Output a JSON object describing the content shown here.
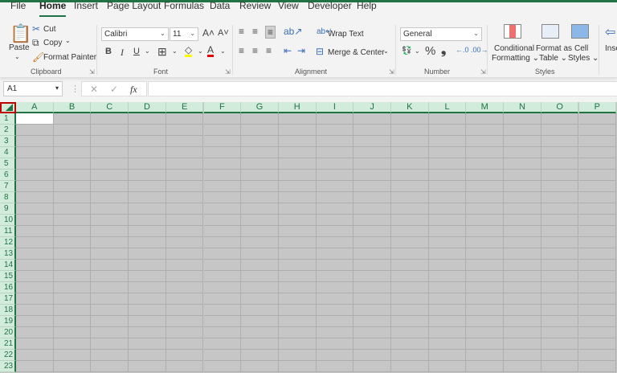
{
  "tabs": [
    "File",
    "Home",
    "Insert",
    "Page Layout",
    "Formulas",
    "Data",
    "Review",
    "View",
    "Developer",
    "Help"
  ],
  "active_tab": "Home",
  "clipboard": {
    "paste": "Paste",
    "cut": "Cut",
    "copy": "Copy",
    "format_painter": "Format Painter",
    "group": "Clipboard"
  },
  "font": {
    "name": "Calibri",
    "size": "11",
    "group": "Font",
    "bold": "B",
    "italic": "I",
    "underline": "U",
    "font_color": "#e00000",
    "highlight_color": "#ffff00"
  },
  "alignment": {
    "wrap_text": "Wrap Text",
    "merge_center": "Merge & Center",
    "group": "Alignment"
  },
  "number": {
    "format": "General",
    "percent": "%",
    "comma": "❟",
    "group": "Number"
  },
  "styles": {
    "conditional": "Conditional",
    "formatting": "Formatting",
    "format_as": "Format as",
    "table": "Table",
    "cell": "Cell",
    "cell_styles": "Styles",
    "group": "Styles"
  },
  "cells_group": {
    "insert": "Inse"
  },
  "formula_bar": {
    "name_box": "A1",
    "fx": "fx",
    "value": ""
  },
  "columns": [
    "A",
    "B",
    "C",
    "D",
    "E",
    "F",
    "G",
    "H",
    "I",
    "J",
    "K",
    "L",
    "M",
    "N",
    "O",
    "P"
  ],
  "rows": [
    "1",
    "2",
    "3",
    "4",
    "5",
    "6",
    "7",
    "8",
    "9",
    "10",
    "11",
    "12",
    "13",
    "14",
    "15",
    "16",
    "17",
    "18",
    "19",
    "20",
    "21",
    "22",
    "23"
  ],
  "selected_cell": "A1"
}
